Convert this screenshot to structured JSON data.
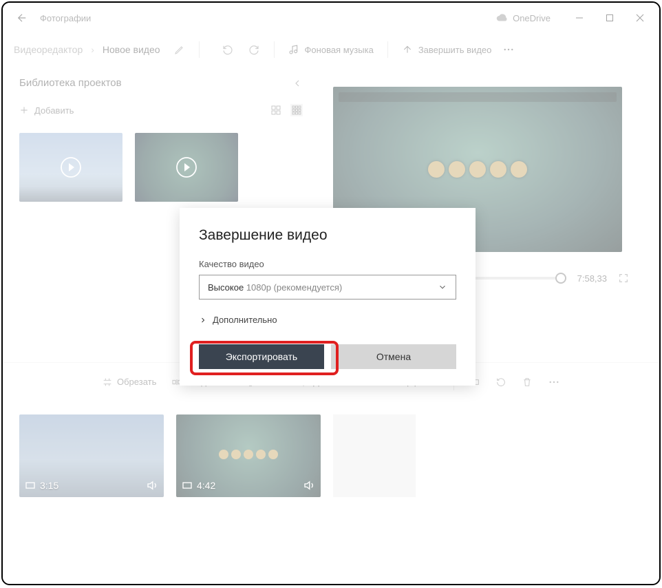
{
  "window": {
    "title": "Фотографии",
    "onedrive": "OneDrive"
  },
  "breadcrumb": {
    "root": "Видеоредактор",
    "project": "Новое видео"
  },
  "toolbar": {
    "music": "Фоновая музыка",
    "finish": "Завершить видео"
  },
  "library": {
    "title": "Библиотека проектов",
    "add": "Добавить"
  },
  "transport": {
    "time": "7:58,33"
  },
  "timeline_tools": {
    "trim": "Обрезать",
    "split": "Разделить",
    "text": "Текст",
    "motion": "Движение",
    "effects3d": "3D-эффекты"
  },
  "clips": {
    "c1": {
      "duration": "3:15"
    },
    "c2": {
      "duration": "4:42"
    }
  },
  "dialog": {
    "title": "Завершение видео",
    "quality_label": "Качество видео",
    "quality_value_1": "Высокое",
    "quality_value_2": "1080p (рекомендуется)",
    "advanced": "Дополнительно",
    "export": "Экспортировать",
    "cancel": "Отмена"
  }
}
